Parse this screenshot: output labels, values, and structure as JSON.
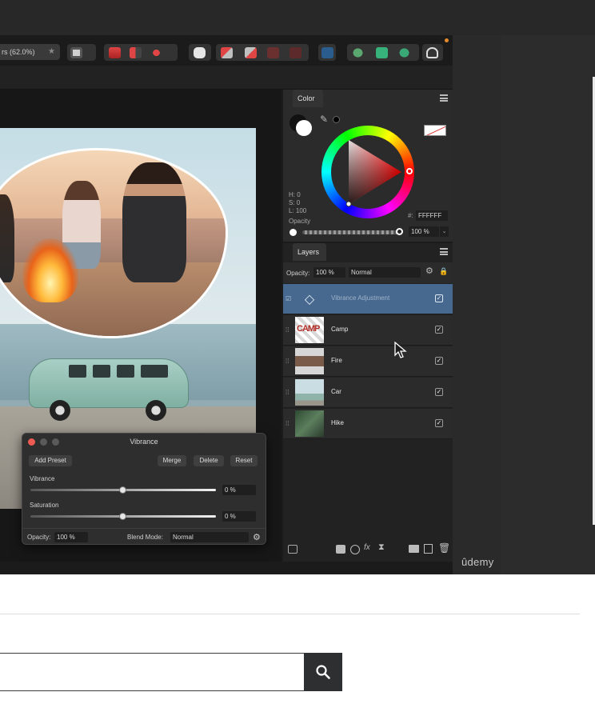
{
  "toolbar": {
    "doc_label": "rs (62.0%)"
  },
  "color_panel": {
    "tab_label": "Color",
    "hsl": {
      "h": "H: 0",
      "s": "S: 0",
      "l": "L: 100"
    },
    "opacity_label": "Opacity",
    "hex_prefix": "#:",
    "hex_value": "FFFFFF",
    "opacity_value": "100 %"
  },
  "layers_panel": {
    "tab_label": "Layers",
    "opacity_label": "Opacity:",
    "opacity_value": "100 %",
    "blend_mode": "Normal",
    "layers": [
      {
        "name": "Vibrance Adjustment",
        "selected": true
      },
      {
        "name": "Camp"
      },
      {
        "name": "Fire"
      },
      {
        "name": "Car"
      },
      {
        "name": "Hike"
      }
    ]
  },
  "vibrance_dialog": {
    "title": "Vibrance",
    "add_preset": "Add Preset",
    "merge": "Merge",
    "delete": "Delete",
    "reset": "Reset",
    "vibrance_label": "Vibrance",
    "vibrance_value": "0 %",
    "vibrance_level": 0.5,
    "saturation_label": "Saturation",
    "saturation_value": "0 %",
    "saturation_level": 0.5,
    "opacity_label": "Opacity:",
    "opacity_value": "100 %",
    "blend_label": "Blend Mode:",
    "blend_value": "Normal"
  },
  "branding": {
    "watermark": "ûdemy"
  },
  "colors": {
    "selected_layer": "#47698f",
    "search_button": "#2d2f31"
  }
}
